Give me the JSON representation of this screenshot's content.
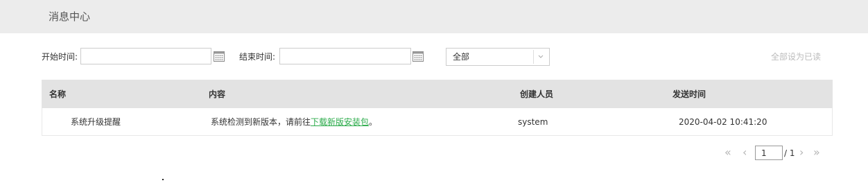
{
  "header": {
    "title": "消息中心"
  },
  "filters": {
    "start_label": "开始时间:",
    "start_value": "",
    "end_label": "结束时间:",
    "end_value": "",
    "status_select": "全部",
    "mark_all_read": "全部设为已读"
  },
  "table": {
    "columns": [
      "名称",
      "内容",
      "创建人员",
      "发送时间"
    ],
    "rows": [
      {
        "name": "系统升级提醒",
        "content_prefix": "系统检测到新版本，请前往",
        "content_link": "下载新版安装包",
        "content_suffix": "。",
        "creator": "system",
        "time": "2020-04-02 10:41:20"
      }
    ]
  },
  "pagination": {
    "first": "«",
    "prev": "‹",
    "current_page": "1",
    "total": "/ 1",
    "next": "›",
    "last": "»"
  },
  "colors": {
    "header_bg": "#ececec",
    "table_header_bg": "#e3e3e3",
    "link_green": "#2bab4a",
    "muted_text": "#bbbbbb"
  },
  "icons": {
    "calendar": "calendar-icon",
    "dropdown": "chevron-down-icon"
  }
}
